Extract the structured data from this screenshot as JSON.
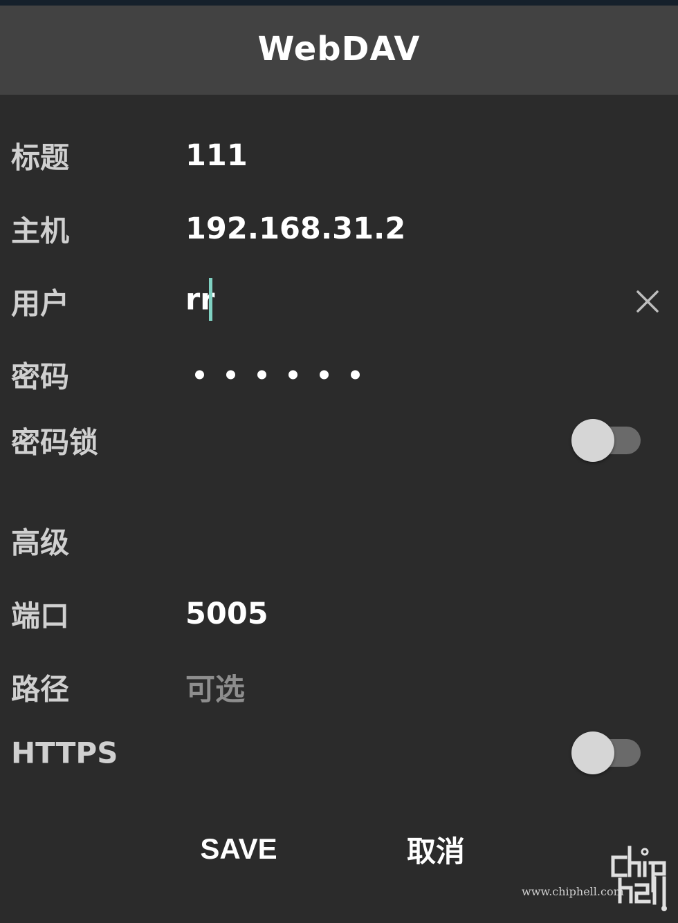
{
  "dialog": {
    "title": "WebDAV"
  },
  "form": {
    "title_field": {
      "label": "标题",
      "value": "111"
    },
    "host_field": {
      "label": "主机",
      "value": "192.168.31.2"
    },
    "user_field": {
      "label": "用户",
      "value": "rr"
    },
    "password_field": {
      "label": "密码",
      "masked_length": 6
    },
    "password_lock": {
      "label": "密码锁",
      "enabled": false
    },
    "advanced_section": {
      "label": "高级"
    },
    "port_field": {
      "label": "端口",
      "value": "5005"
    },
    "path_field": {
      "label": "路径",
      "placeholder": "可选"
    },
    "https_toggle": {
      "label": "HTTPS",
      "enabled": false
    }
  },
  "actions": {
    "save_label": "SAVE",
    "cancel_label": "取消"
  },
  "watermark": {
    "site": "www.chiphell.com"
  },
  "colors": {
    "background": "#2b2b2b",
    "titlebar": "#424242",
    "caret": "#7fd1c2",
    "toggle_thumb": "#d6d6d6",
    "toggle_track": "#6a6a6a"
  },
  "icons": {
    "clear": "close-icon"
  }
}
